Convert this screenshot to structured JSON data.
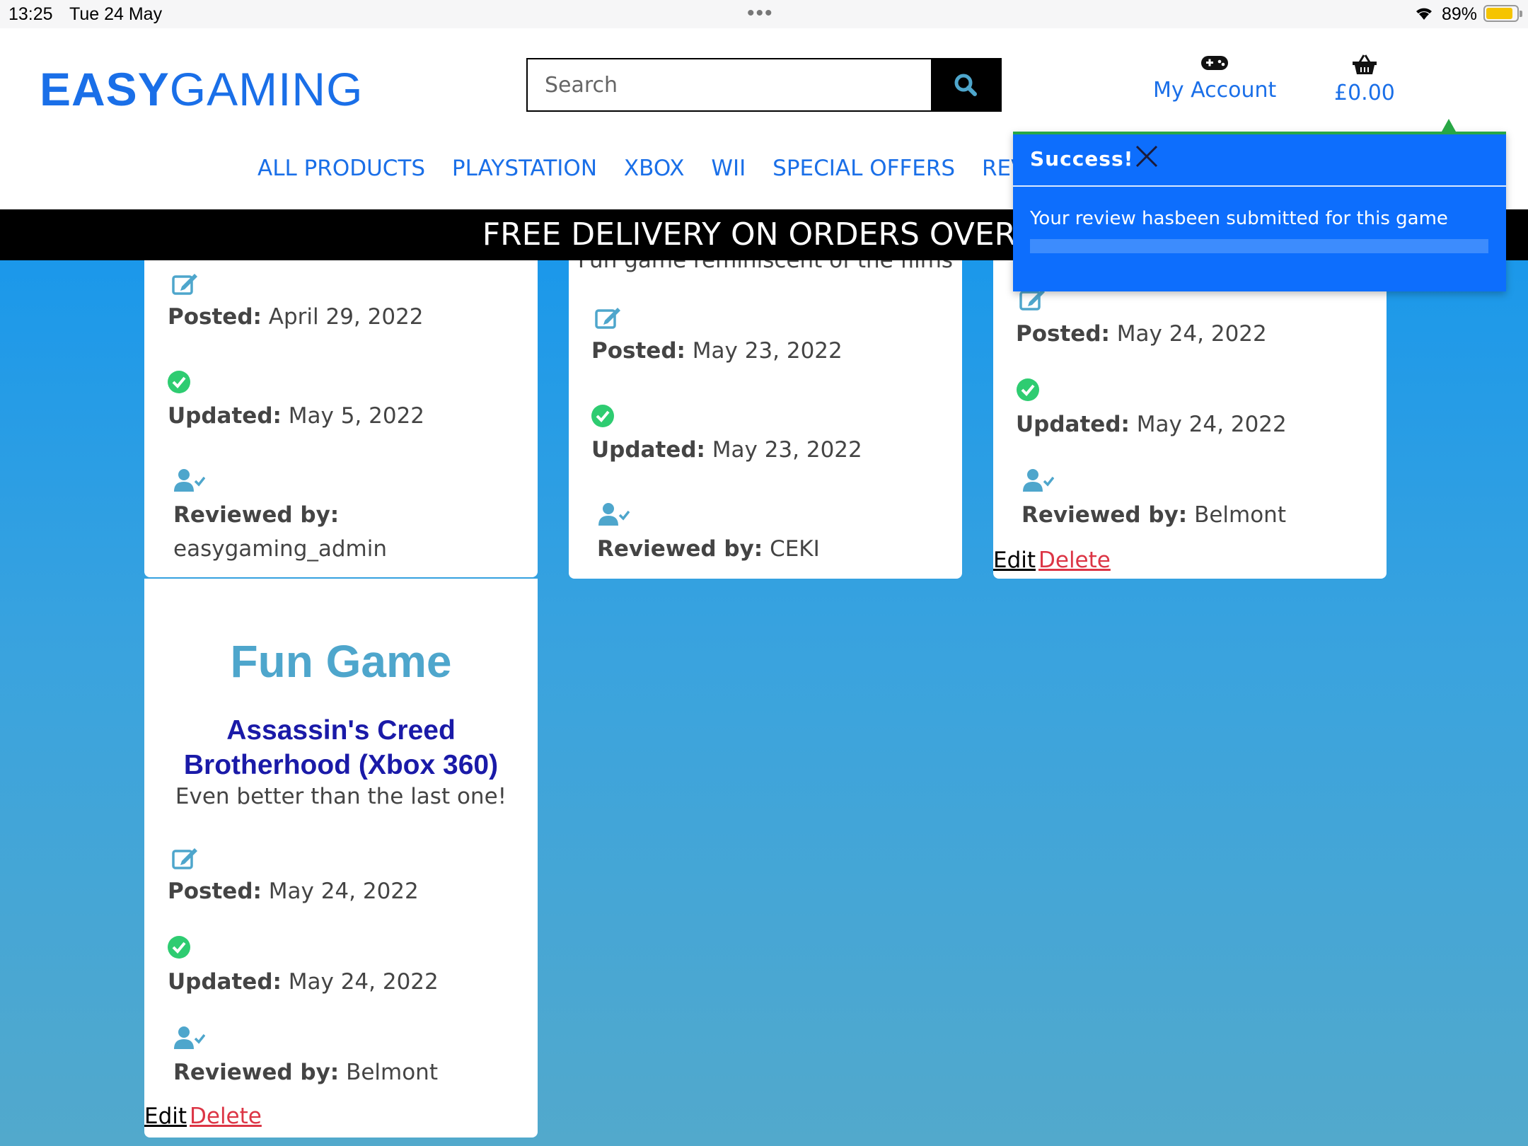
{
  "status_bar": {
    "time": "13:25",
    "date": "Tue 24 May",
    "dots": "•••",
    "battery_pct": "89%",
    "battery_level": 0.89
  },
  "header": {
    "logo_part1": "EASY",
    "logo_part2": "GAMING",
    "search_placeholder": "Search",
    "account_label": "My Account",
    "basket_total": "£0.00",
    "nav": [
      "ALL PRODUCTS",
      "PLAYSTATION",
      "XBOX",
      "WII",
      "SPECIAL OFFERS",
      "REVIE"
    ]
  },
  "banner": "FREE DELIVERY ON ORDERS OVER £",
  "cards": [
    {
      "posted_label": "Posted:",
      "posted": "April 29, 2022",
      "updated_label": "Updated:",
      "updated": "May 5, 2022",
      "reviewed_label": "Reviewed by:",
      "reviewer": "easygaming_admin"
    },
    {
      "desc": "Fun game reminiscent of the films",
      "posted_label": "Posted:",
      "posted": "May 23, 2022",
      "updated_label": "Updated:",
      "updated": "May 23, 2022",
      "reviewed_label": "Reviewed by:",
      "reviewer": "CEKI"
    },
    {
      "posted_label": "Posted:",
      "posted": "May 24, 2022",
      "updated_label": "Updated:",
      "updated": "May 24, 2022",
      "reviewed_label": "Reviewed by:",
      "reviewer": "Belmont",
      "edit": "Edit",
      "delete": "Delete"
    },
    {
      "title": "Fun Game",
      "game_line1": "Assassin's Creed",
      "game_line2": "Brotherhood (Xbox 360)",
      "desc": "Even better than the last one!",
      "posted_label": "Posted:",
      "posted": "May 24, 2022",
      "updated_label": "Updated:",
      "updated": "May 24, 2022",
      "reviewed_label": "Reviewed by:",
      "reviewer": "Belmont",
      "edit": "Edit",
      "delete": "Delete"
    }
  ],
  "toast": {
    "title": "Success!",
    "message": "Your review hasbeen submitted for this game"
  },
  "colors": {
    "accent": "#1a6fe8",
    "toast_bg": "#0d6efd",
    "success_green": "#28a745",
    "delete_red": "#dc3545",
    "icon_teal": "#4ea6cc"
  },
  "icons": [
    "search-icon",
    "gamepad-icon",
    "basket-icon",
    "edit-icon",
    "check-circle-icon",
    "user-check-icon",
    "close-icon",
    "wifi-icon",
    "battery-icon"
  ]
}
